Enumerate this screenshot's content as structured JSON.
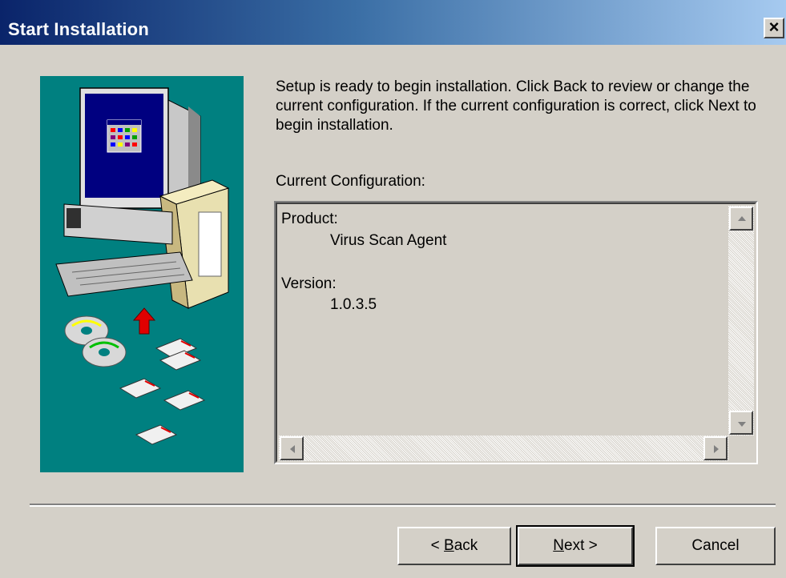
{
  "window": {
    "title": "Start Installation",
    "close_label": "×"
  },
  "intro_text": "Setup is ready to begin installation. Click Back to review or change the current configuration. If the current configuration is correct, click Next to begin installation.",
  "config_label": "Current Configuration:",
  "config": {
    "product_label": "Product:",
    "product_value": "Virus Scan Agent",
    "version_label": "Version:",
    "version_value": "1.0.3.5"
  },
  "buttons": {
    "back_prefix": "< ",
    "back_hotkey": "B",
    "back_rest": "ack",
    "next_hotkey": "N",
    "next_rest": "ext >",
    "cancel": "Cancel"
  },
  "icons": {
    "art": "install-computer-illustration",
    "scroll_up": "arrow-up-icon",
    "scroll_down": "arrow-down-icon",
    "scroll_left": "arrow-left-icon",
    "scroll_right": "arrow-right-icon"
  },
  "colors": {
    "titlebar_start": "#0a246a",
    "titlebar_end": "#a6caf0",
    "art_background": "#008080",
    "window_background": "#d4d0c8"
  }
}
